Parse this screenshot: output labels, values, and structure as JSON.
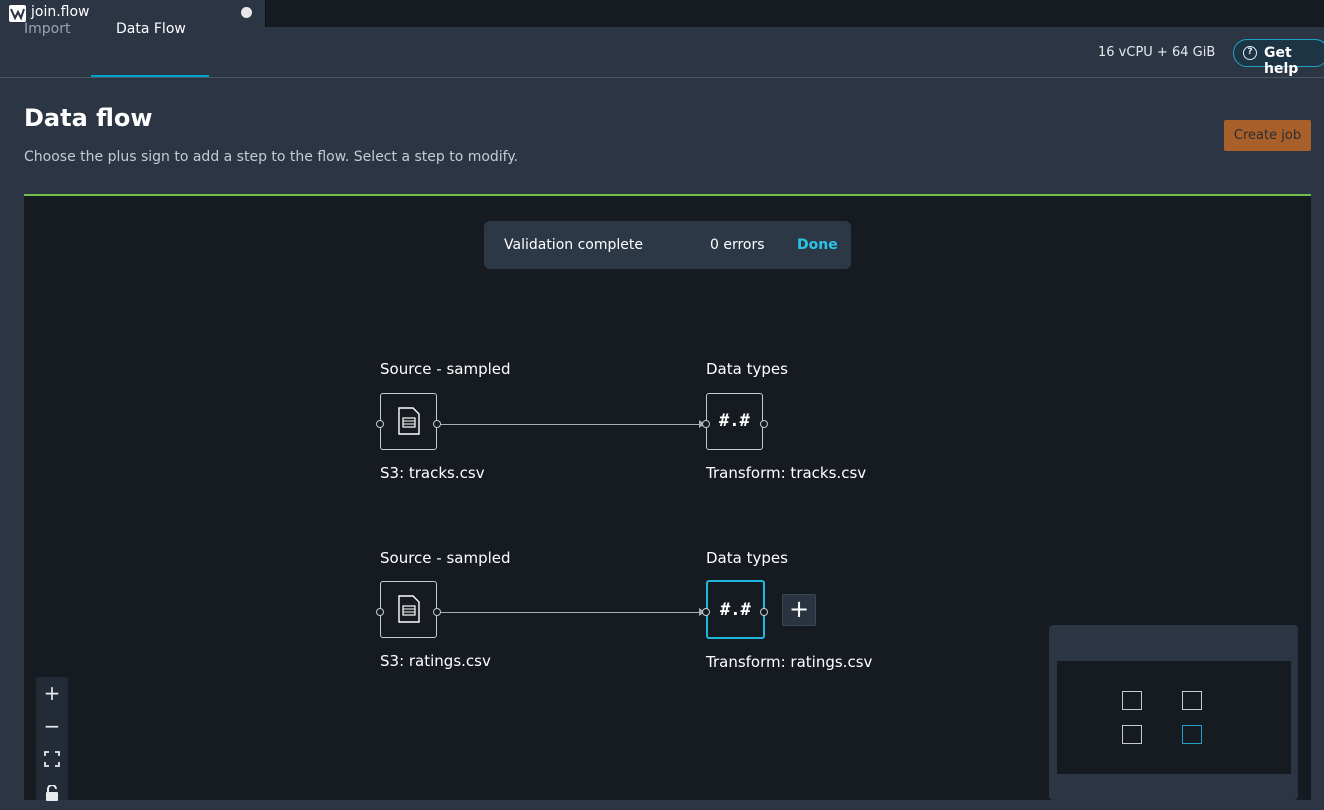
{
  "file_tab": {
    "title": "join.flow",
    "logo_icon": "sagemaker-logo-icon",
    "unsaved_indicator": "dot"
  },
  "tabs": [
    {
      "label": "Import",
      "active": false
    },
    {
      "label": "Data Flow",
      "active": true
    }
  ],
  "toolbar": {
    "resources": "16 vCPU + 64 GiB",
    "help_label": "Get help",
    "help_icon": "question-circle-icon"
  },
  "header": {
    "title": "Data flow",
    "description": "Choose the plus sign to add a step to the flow. Select a step to modify.",
    "create_job_label": "Create job"
  },
  "toast": {
    "title": "Validation complete",
    "errors": "0 errors",
    "done_label": "Done"
  },
  "flows": [
    {
      "source": {
        "label_top": "Source - sampled",
        "label_bottom": "S3: tracks.csv",
        "icon": "file-icon"
      },
      "transform": {
        "label_top": "Data types",
        "label_bottom": "Transform: tracks.csv",
        "glyph": "#.#",
        "selected": false
      }
    },
    {
      "source": {
        "label_top": "Source - sampled",
        "label_bottom": "S3: ratings.csv",
        "icon": "file-icon"
      },
      "transform": {
        "label_top": "Data types",
        "label_bottom": "Transform: ratings.csv",
        "glyph": "#.#",
        "selected": true
      }
    }
  ],
  "add_step": {
    "label": "+"
  },
  "zoom_controls": [
    {
      "name": "zoom-in",
      "glyph": "+"
    },
    {
      "name": "zoom-out",
      "glyph": "−"
    },
    {
      "name": "fit-view",
      "glyph": "⛶"
    },
    {
      "name": "lock",
      "glyph": "🔒"
    }
  ],
  "colors": {
    "accent": "#00a1c9",
    "create_job": "#a85f2a",
    "canvas_border": "#6dbf4a",
    "done_link": "#2bc3e6"
  }
}
